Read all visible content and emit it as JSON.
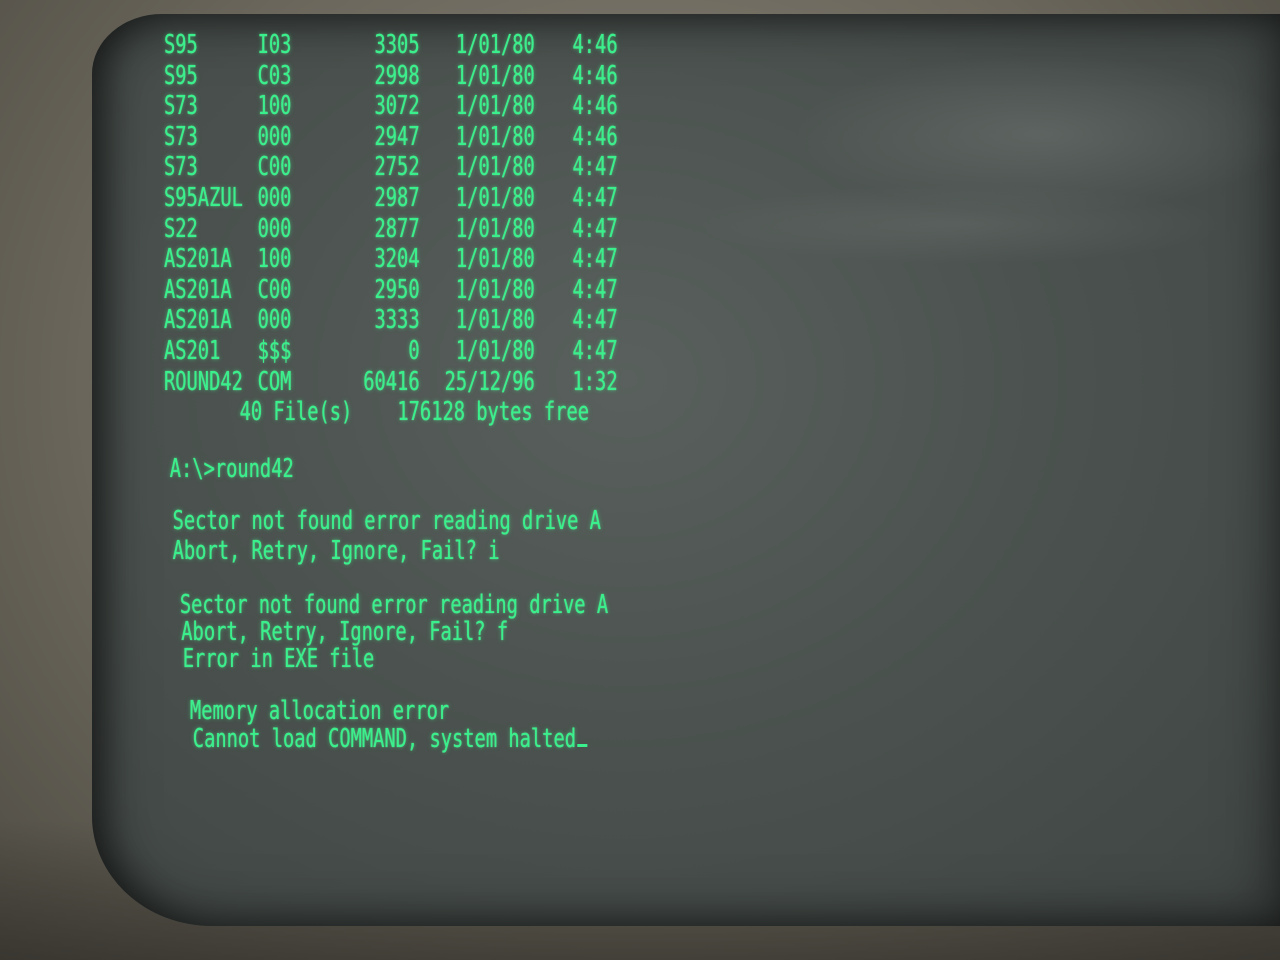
{
  "directory": {
    "rows": [
      {
        "name": "S95",
        "ext": "I03",
        "size": "3305",
        "date": "1/01/80",
        "time": "4:46"
      },
      {
        "name": "S95",
        "ext": "C03",
        "size": "2998",
        "date": "1/01/80",
        "time": "4:46"
      },
      {
        "name": "S73",
        "ext": "100",
        "size": "3072",
        "date": "1/01/80",
        "time": "4:46"
      },
      {
        "name": "S73",
        "ext": "000",
        "size": "2947",
        "date": "1/01/80",
        "time": "4:46"
      },
      {
        "name": "S73",
        "ext": "C00",
        "size": "2752",
        "date": "1/01/80",
        "time": "4:47"
      },
      {
        "name": "S95AZUL",
        "ext": "000",
        "size": "2987",
        "date": "1/01/80",
        "time": "4:47"
      },
      {
        "name": "S22",
        "ext": "000",
        "size": "2877",
        "date": "1/01/80",
        "time": "4:47"
      },
      {
        "name": "AS201A",
        "ext": "100",
        "size": "3204",
        "date": "1/01/80",
        "time": "4:47"
      },
      {
        "name": "AS201A",
        "ext": "C00",
        "size": "2950",
        "date": "1/01/80",
        "time": "4:47"
      },
      {
        "name": "AS201A",
        "ext": "000",
        "size": "3333",
        "date": "1/01/80",
        "time": "4:47"
      },
      {
        "name": "AS201",
        "ext": "$$$",
        "size": "0",
        "date": "1/01/80",
        "time": "4:47"
      },
      {
        "name": "ROUND42",
        "ext": "COM",
        "size": "60416",
        "date": "25/12/96",
        "time": "1:32"
      }
    ],
    "summary": "40 File(s)    176128 bytes free"
  },
  "prompt": {
    "command": "A:\\>round42"
  },
  "errors": {
    "first_line1": "Sector not found error reading drive A",
    "first_line2": "Abort, Retry, Ignore, Fail? i",
    "second_line1": "Sector not found error reading drive A",
    "second_line2": "Abort, Retry, Ignore, Fail? f",
    "second_line3": "Error in EXE file",
    "final_line1": "Memory allocation error",
    "final_line2": "Cannot load COMMAND, system halted"
  },
  "colors": {
    "phosphor": "#39f08c",
    "screen": "#4b524f",
    "bezel": "#7a766a"
  }
}
